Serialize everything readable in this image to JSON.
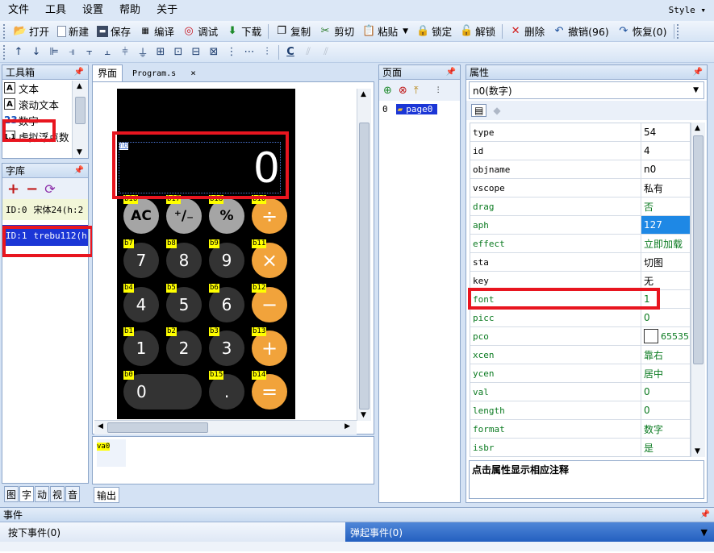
{
  "menu": {
    "items": [
      "文件",
      "工具",
      "设置",
      "帮助",
      "关于"
    ],
    "style": "Style ▾"
  },
  "toolbar1": [
    {
      "icon": "folder-open-icon",
      "label": "打开"
    },
    {
      "icon": "new-file-icon",
      "label": "新建"
    },
    {
      "icon": "save-icon",
      "label": "保存"
    },
    {
      "icon": "compile-icon",
      "label": "编译"
    },
    {
      "icon": "debug-icon",
      "label": "调试"
    },
    {
      "icon": "download-icon",
      "label": "下载"
    },
    {
      "icon": "copy-icon",
      "label": "复制"
    },
    {
      "icon": "cut-icon",
      "label": "剪切"
    },
    {
      "icon": "paste-icon",
      "label": "粘贴"
    },
    {
      "icon": "lock-icon",
      "label": "锁定"
    },
    {
      "icon": "unlock-icon",
      "label": "解锁"
    },
    {
      "icon": "delete-icon",
      "label": "删除"
    },
    {
      "icon": "undo-icon",
      "label": "撤销(96)"
    },
    {
      "icon": "redo-icon",
      "label": "恢复(0)"
    }
  ],
  "toolbox": {
    "title": "工具箱",
    "items": [
      {
        "icon": "A",
        "label": "文本"
      },
      {
        "icon": "A",
        "label": "滚动文本"
      },
      {
        "icon": "23",
        "label": "数字"
      },
      {
        "icon": "1.1",
        "label": "虚拟浮点数"
      }
    ]
  },
  "fontlib": {
    "title": "字库",
    "items": [
      {
        "id": "ID:0",
        "name": "宋体24(h:2"
      },
      {
        "id": "ID:1",
        "name": "trebu112(h"
      }
    ]
  },
  "left_tabs": [
    "图",
    "字",
    "动",
    "视",
    "音"
  ],
  "editor": {
    "tabs": [
      {
        "label": "界面"
      },
      {
        "label": "Program.s"
      }
    ],
    "tab_close": "×",
    "number_label": "n0",
    "number_value": "0",
    "buttons": [
      {
        "label": "AC",
        "tag": "b16",
        "style": "light"
      },
      {
        "label": "⁺∕₋",
        "tag": "b17",
        "style": "light"
      },
      {
        "label": "%",
        "tag": "b18",
        "style": "light"
      },
      {
        "label": "÷",
        "tag": "b10",
        "style": "orange"
      },
      {
        "label": "7",
        "tag": "b7",
        "style": "dark"
      },
      {
        "label": "8",
        "tag": "b8",
        "style": "dark"
      },
      {
        "label": "9",
        "tag": "b9",
        "style": "dark"
      },
      {
        "label": "×",
        "tag": "b11",
        "style": "orange"
      },
      {
        "label": "4",
        "tag": "b4",
        "style": "dark"
      },
      {
        "label": "5",
        "tag": "b5",
        "style": "dark"
      },
      {
        "label": "6",
        "tag": "b6",
        "style": "dark"
      },
      {
        "label": "−",
        "tag": "b12",
        "style": "orange"
      },
      {
        "label": "1",
        "tag": "b1",
        "style": "dark"
      },
      {
        "label": "2",
        "tag": "b2",
        "style": "dark"
      },
      {
        "label": "3",
        "tag": "b3",
        "style": "dark"
      },
      {
        "label": "+",
        "tag": "b13",
        "style": "orange"
      },
      {
        "label": "0",
        "tag": "b0",
        "style": "wide"
      },
      {
        "label": ".",
        "tag": "b15",
        "style": "dark"
      },
      {
        "label": "=",
        "tag": "b14",
        "style": "orange"
      }
    ],
    "var_label": "va0",
    "output_tab": "输出"
  },
  "pages": {
    "title": "页面",
    "items": [
      {
        "index": "0",
        "name": "page0"
      }
    ]
  },
  "props": {
    "title": "属性",
    "selected": "n0(数字)",
    "rows": [
      {
        "name": "type",
        "value": "54",
        "green": false
      },
      {
        "name": "id",
        "value": "4",
        "green": false
      },
      {
        "name": "objname",
        "value": "n0",
        "green": false
      },
      {
        "name": "vscope",
        "value": "私有",
        "green": false
      },
      {
        "name": "drag",
        "value": "否",
        "green": true
      },
      {
        "name": "aph",
        "value": "127",
        "green": true
      },
      {
        "name": "effect",
        "value": "立即加载",
        "green": true
      },
      {
        "name": "sta",
        "value": "切图",
        "green": false
      },
      {
        "name": "key",
        "value": "无",
        "green": false
      },
      {
        "name": "font",
        "value": "1",
        "green": true
      },
      {
        "name": "picc",
        "value": "0",
        "green": true
      },
      {
        "name": "pco",
        "value": "65535",
        "green": true
      },
      {
        "name": "xcen",
        "value": "靠右",
        "green": true
      },
      {
        "name": "ycen",
        "value": "居中",
        "green": true
      },
      {
        "name": "val",
        "value": "0",
        "green": true
      },
      {
        "name": "length",
        "value": "0",
        "green": true
      },
      {
        "name": "format",
        "value": "数字",
        "green": true
      },
      {
        "name": "isbr",
        "value": "是",
        "green": true
      }
    ],
    "note": "点击属性显示相应注释"
  },
  "events": {
    "title": "事件",
    "tab_press": "按下事件(0)",
    "tab_release": "弹起事件(0)"
  }
}
